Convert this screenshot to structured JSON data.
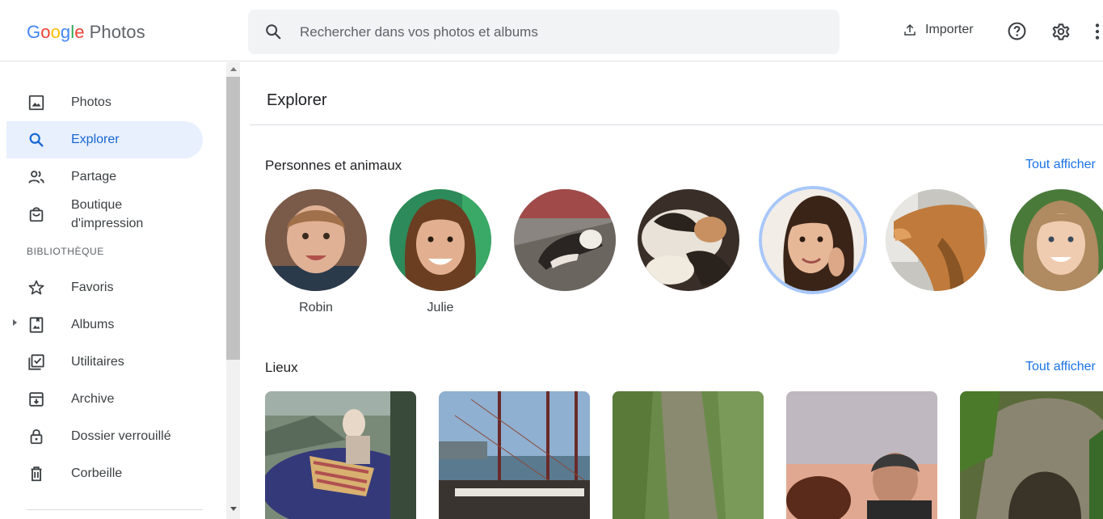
{
  "app": {
    "logo": {
      "g": "G",
      "o1": "o",
      "o2": "o",
      "g2": "g",
      "l": "l",
      "e": "e",
      "product": "Photos"
    }
  },
  "search": {
    "placeholder": "Rechercher dans vos photos et albums",
    "icon": "search-icon"
  },
  "header": {
    "import_label": "Importer",
    "icons": [
      "upload-icon",
      "help-icon",
      "settings-icon",
      "more-vert-icon"
    ]
  },
  "sidebar": {
    "items": [
      {
        "label": "Photos",
        "icon": "photo-icon"
      },
      {
        "label": "Explorer",
        "icon": "search-icon",
        "active": true
      },
      {
        "label": "Partage",
        "icon": "people-icon"
      },
      {
        "label_line1": "Boutique",
        "label_line2": "d'impression",
        "icon": "shopping-bag-icon"
      },
      {
        "label": "Favoris",
        "icon": "star-icon"
      },
      {
        "label": "Albums",
        "icon": "album-icon"
      },
      {
        "label": "Utilitaires",
        "icon": "utilities-icon"
      },
      {
        "label": "Archive",
        "icon": "archive-icon"
      },
      {
        "label": "Dossier verrouillé",
        "icon": "lock-icon"
      },
      {
        "label": "Corbeille",
        "icon": "trash-icon"
      }
    ],
    "section_library": "BIBLIOTHÈQUE"
  },
  "main": {
    "title": "Explorer",
    "people_section": {
      "title": "Personnes et animaux",
      "see_all": "Tout afficher",
      "people": [
        {
          "name": "Robin",
          "color": "#b07a5a"
        },
        {
          "name": "Julie",
          "color": "#8a5a3a"
        },
        {
          "name": "",
          "color": "#6b5f5a"
        },
        {
          "name": "",
          "color": "#4a3f38"
        },
        {
          "name": "",
          "color": "#c9a68c",
          "selected": true
        },
        {
          "name": "",
          "color": "#c07b3c"
        },
        {
          "name": "",
          "color": "#b89a7a"
        }
      ]
    },
    "places_section": {
      "title": "Lieux",
      "see_all": "Tout afficher",
      "places": [
        {
          "color": "#3a3f7a"
        },
        {
          "color": "#6f93b8"
        },
        {
          "color": "#6a8a4a"
        },
        {
          "color": "#b08a7a"
        },
        {
          "color": "#6b6552"
        }
      ]
    }
  }
}
